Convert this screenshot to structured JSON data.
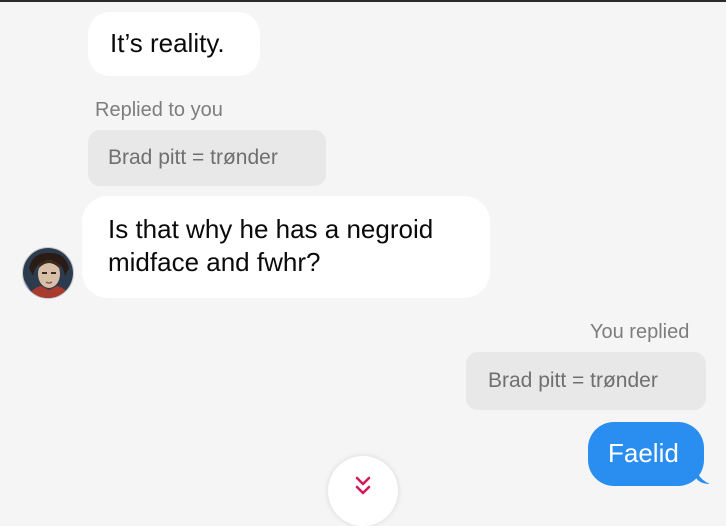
{
  "conversation": {
    "messages": [
      {
        "text": "It’s reality."
      },
      {
        "reply_label": "Replied to you",
        "quote": "Brad pitt = trønder",
        "text": "Is that why he has a negroid midface and fwhr?"
      },
      {
        "reply_label": "You replied",
        "quote": "Brad pitt = trønder",
        "text": "Faelid"
      }
    ]
  },
  "colors": {
    "background": "#f5f5f5",
    "incoming_bubble": "#ffffff",
    "outgoing_bubble": "#2a8ef0",
    "quote_bubble": "#e8e8e8",
    "scroll_arrow": "#d4195a"
  },
  "icons": {
    "scroll_down": "double-chevron-down-icon",
    "avatar": "user-avatar"
  }
}
